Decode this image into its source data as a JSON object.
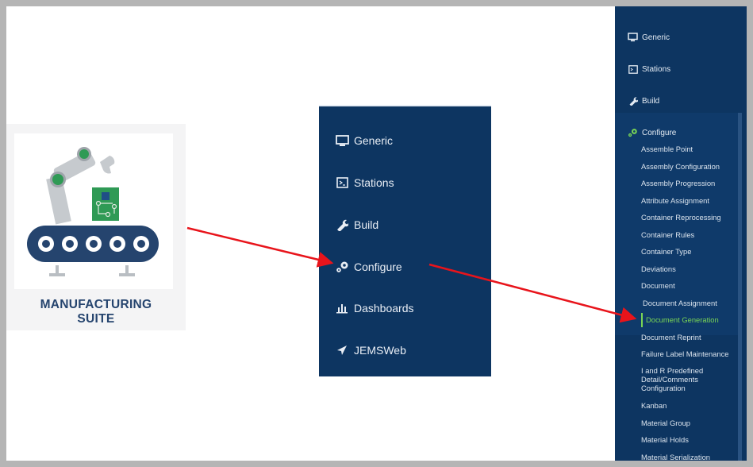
{
  "suite": {
    "title_line1": "MANUFACTURING",
    "title_line2": "SUITE"
  },
  "middle_menu": {
    "items": [
      {
        "label": "Generic",
        "icon": "monitor-icon"
      },
      {
        "label": "Stations",
        "icon": "stations-icon"
      },
      {
        "label": "Build",
        "icon": "wrench-icon"
      },
      {
        "label": "Configure",
        "icon": "gears-icon"
      },
      {
        "label": "Dashboards",
        "icon": "bar-chart-icon"
      },
      {
        "label": "JEMSWeb",
        "icon": "send-arrow-icon"
      }
    ]
  },
  "right_menu": {
    "top_items": [
      {
        "label": "Generic",
        "icon": "monitor-icon"
      },
      {
        "label": "Stations",
        "icon": "stations-icon"
      },
      {
        "label": "Build",
        "icon": "wrench-icon"
      },
      {
        "label": "Configure",
        "icon": "gears-icon"
      }
    ],
    "configure_subitems": [
      "Assemble Point",
      "Assembly Configuration",
      "Assembly Progression",
      "Attribute Assignment",
      "Container Reprocessing",
      "Container Rules",
      "Container Type",
      "Deviations",
      "Document",
      "Document Assignment",
      "Document Generation",
      "Document Reprint",
      "Failure Label Maintenance",
      "I and R Predefined Detail/Comments Configuration",
      "Kanban",
      "Material Group",
      "Material Holds",
      "Material Serialization"
    ],
    "active_item": "Document Generation"
  },
  "colors": {
    "menu_bg": "#0d3561",
    "active_green": "#7ad655",
    "arrow_red": "#e8141b",
    "title_blue": "#25446e"
  }
}
